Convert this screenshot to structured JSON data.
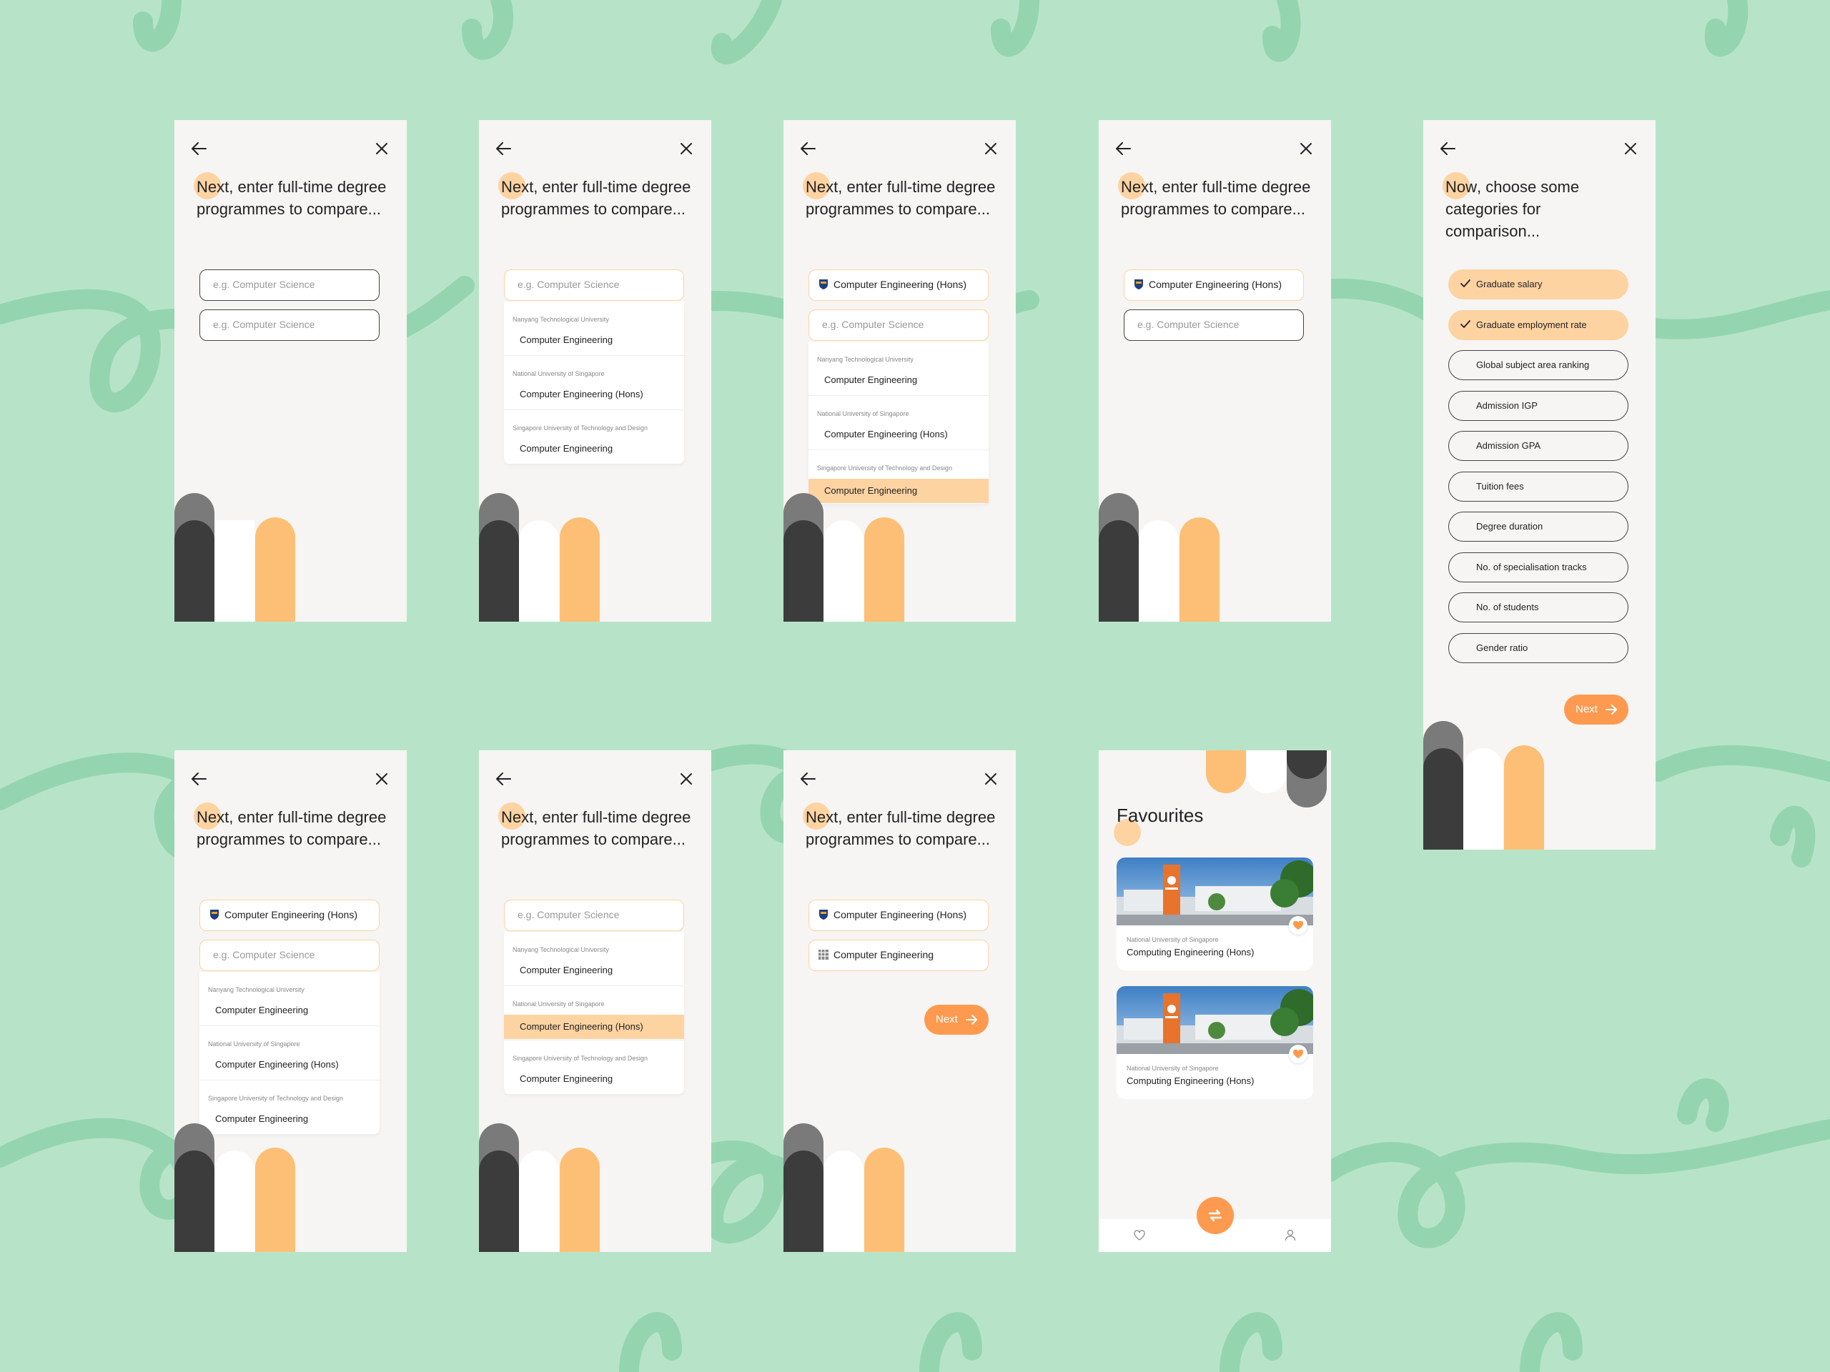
{
  "colors": {
    "background": "#b7e4c8",
    "squiggle": "#94d5b0",
    "screen": "#f6f5f3",
    "accent": "#fd9a4f",
    "highlight": "#fdd3a2",
    "dark": "#3c3c3c",
    "grey": "#7a7a7a",
    "text": "#222222"
  },
  "heading_highlight": "Next",
  "heading_rest": ", enter full-time degree programmes to compare...",
  "placeholder": "e.g. Computer Science",
  "programmes": {
    "ntu_uni": "Nanyang Technological University",
    "ntu_prog": "Computer Engineering",
    "nus_uni": "National University of Singapore",
    "nus_prog": "Computer Engineering (Hons)",
    "sutd_uni": "Singapore University of Technology and Design",
    "sutd_prog": "Computer Engineering"
  },
  "selected": {
    "nus": "Computer Engineering  (Hons)",
    "ntu": "Computer Engineering"
  },
  "next_label": "Next",
  "categories_screen": {
    "heading_highlight": "Now",
    "heading_rest": ", choose some categories for comparison...",
    "categories": [
      {
        "label": "Graduate salary",
        "selected": true
      },
      {
        "label": "Graduate employment rate",
        "selected": true
      },
      {
        "label": "Global subject area ranking",
        "selected": false
      },
      {
        "label": "Admission IGP",
        "selected": false
      },
      {
        "label": "Admission GPA",
        "selected": false
      },
      {
        "label": "Tuition fees",
        "selected": false
      },
      {
        "label": "Degree duration",
        "selected": false
      },
      {
        "label": "No. of specialisation tracks",
        "selected": false
      },
      {
        "label": "No. of students",
        "selected": false
      },
      {
        "label": "Gender ratio",
        "selected": false
      }
    ]
  },
  "favourites": {
    "title": "Favourites",
    "cards": [
      {
        "uni": "National University of Singapore",
        "prog": "Computing Engineering (Hons)"
      },
      {
        "uni": "National University of Singapore",
        "prog": "Computing Engineering (Hons)"
      }
    ]
  },
  "icons": {
    "back": "arrow-left-icon",
    "close": "x-icon",
    "check": "check-icon",
    "arrow": "arrow-right-icon",
    "heart": "heart-icon",
    "swap": "swap-icon",
    "profile": "user-icon"
  }
}
